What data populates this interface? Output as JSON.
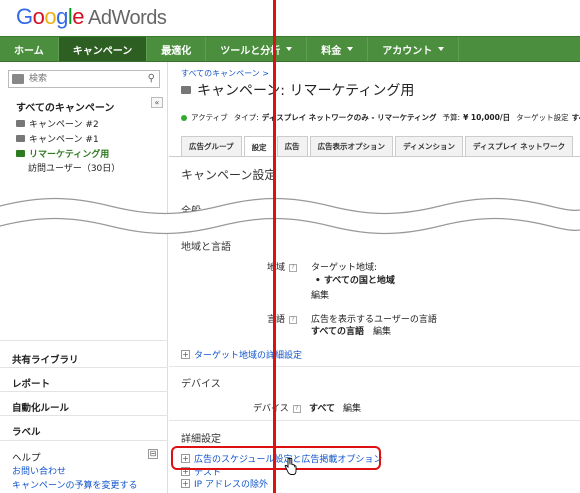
{
  "logo": {
    "brand": "Google",
    "product": "AdWords"
  },
  "nav": [
    {
      "label": "ホーム",
      "active": false,
      "dropdown": false
    },
    {
      "label": "キャンペーン",
      "active": true,
      "dropdown": false
    },
    {
      "label": "最適化",
      "active": false,
      "dropdown": false
    },
    {
      "label": "ツールと分析",
      "active": false,
      "dropdown": true
    },
    {
      "label": "料金",
      "active": false,
      "dropdown": true
    },
    {
      "label": "アカウント",
      "active": false,
      "dropdown": true
    }
  ],
  "sidebar": {
    "search_placeholder": "検索",
    "collapse": "«",
    "all_campaigns": "すべてのキャンペーン",
    "campaigns": [
      {
        "label": "キャンペーン #2",
        "active": false
      },
      {
        "label": "キャンペーン #1",
        "active": false
      },
      {
        "label": "リマーケティング用",
        "active": true
      }
    ],
    "audience": "訪問ユーザー（30日）",
    "sections": [
      "共有ライブラリ",
      "レポート",
      "自動化ルール",
      "ラベル"
    ],
    "help": {
      "title": "ヘルプ",
      "toggle": "⊟",
      "links": [
        "お問い合わせ",
        "キャンペーンの予算を変更する"
      ]
    }
  },
  "main": {
    "breadcrumb": "すべてのキャンペーン >",
    "title": "キャンペーン: リマーケティング用",
    "status": {
      "state": "アクティブ",
      "type_label": "タイプ:",
      "type_value": "ディスプレイ ネットワークのみ - リマーケティング",
      "budget_label": "予算:",
      "budget_value": "¥ 10,000/日",
      "targeting_label": "ターゲット設定",
      "targeting_value": "すべての"
    },
    "tabs": [
      "広告グループ",
      "設定",
      "広告",
      "広告表示オプション",
      "ディメンション",
      "ディスプレイ ネットワーク"
    ],
    "active_tab": 1,
    "settings_title": "キャンペーン設定",
    "general": "全般",
    "region_language": "地域と言語",
    "location_label": "地域",
    "target_region_label": "ターゲット地域:",
    "target_region_value": "すべての国と地域",
    "edit": "編集",
    "language_label": "言語",
    "language_desc": "広告を表示するユーザーの言語",
    "language_value": "すべての言語",
    "target_detail_link": "ターゲット地域の詳細設定",
    "devices_title": "デバイス",
    "devices_label": "デバイス",
    "devices_value": "すべて",
    "advanced_title": "詳細設定",
    "schedule_link": "広告のスケジュール設定と広告掲載オプション",
    "hidden_item": "テスト",
    "ip_exclusion": "IP アドレスの除外"
  }
}
